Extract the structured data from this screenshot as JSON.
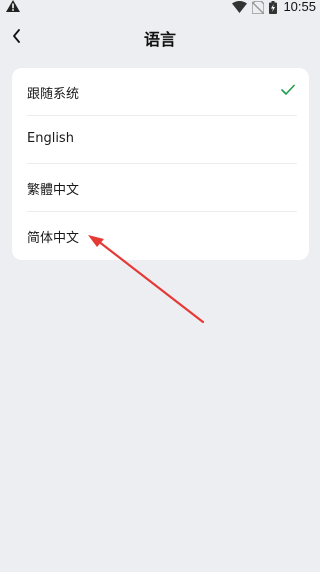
{
  "status_bar": {
    "time": "10:55",
    "icons": [
      "warning-icon",
      "wifi-icon",
      "no-sim-icon",
      "battery-charging-icon"
    ]
  },
  "header": {
    "back_icon": "chevron-left-icon",
    "title": "语言"
  },
  "languages": {
    "items": [
      {
        "label": "跟随系统",
        "selected": true
      },
      {
        "label": "English",
        "selected": false
      },
      {
        "label": "繁體中文",
        "selected": false
      },
      {
        "label": "简体中文",
        "selected": false
      }
    ],
    "check_icon": "checkmark-icon",
    "check_color": "#1e9e4a"
  },
  "annotation": {
    "icon": "red-arrow-icon",
    "color": "#e53935"
  }
}
